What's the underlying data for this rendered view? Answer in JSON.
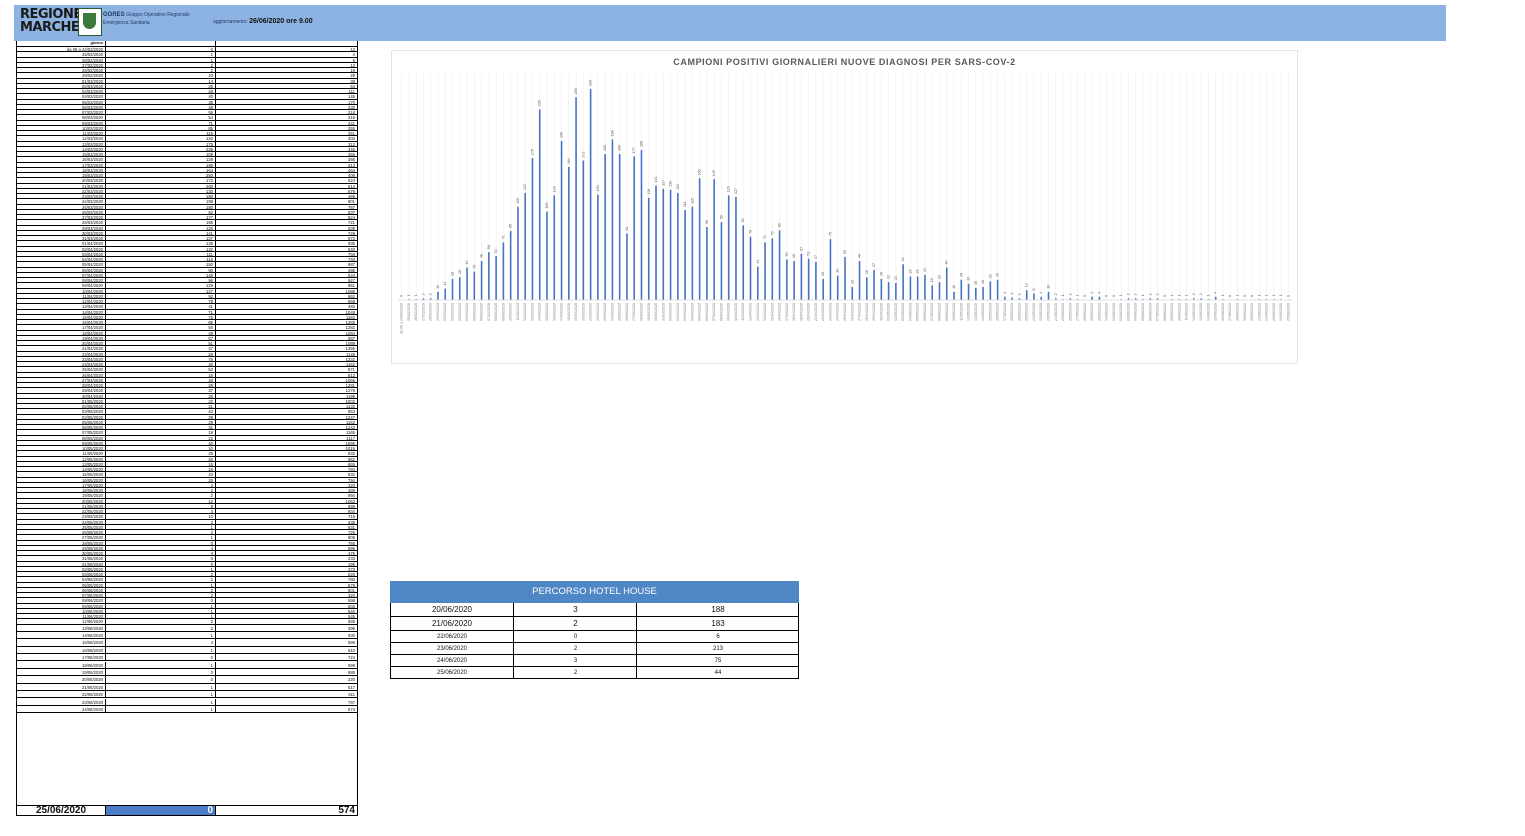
{
  "header": {
    "logo_line1": "REGIONE",
    "logo_line2": "MARCHE",
    "org_name": "GORES",
    "org_line1": "Gruppo Operativo Regionale",
    "org_line2": "Emergenza Sanitaria",
    "update_label": "aggiornamento:",
    "update_value": "26/06/2020 ore 9.00"
  },
  "table": {
    "col0_header": "giorno",
    "rows": [
      [
        "da 06 a 24/02/2020",
        "0",
        "12"
      ],
      [
        "25/02/2020",
        "1",
        "4"
      ],
      [
        "26/02/2020",
        "1",
        "6"
      ],
      [
        "27/02/2020",
        "2",
        "13"
      ],
      [
        "28/02/2020",
        "2",
        "19"
      ],
      [
        "29/02/2020",
        "10",
        "29"
      ],
      [
        "01/03/2020",
        "14",
        "38"
      ],
      [
        "02/03/2020",
        "26",
        "64"
      ],
      [
        "03/03/2020",
        "28",
        "111"
      ],
      [
        "04/03/2020",
        "40",
        "145"
      ],
      [
        "05/03/2020",
        "35",
        "170"
      ],
      [
        "06/03/2020",
        "48",
        "230"
      ],
      [
        "07/03/2020",
        "59",
        "218"
      ],
      [
        "08/03/2020",
        "54",
        "216"
      ],
      [
        "09/03/2020",
        "71",
        "241"
      ],
      [
        "10/03/2020",
        "85",
        "255"
      ],
      [
        "11/03/2020",
        "115",
        "251"
      ],
      [
        "12/03/2020",
        "132",
        "303"
      ],
      [
        "13/03/2020",
        "175",
        "312"
      ],
      [
        "14/03/2020",
        "235",
        "346"
      ],
      [
        "15/03/2020",
        "109",
        "355"
      ],
      [
        "16/03/2020",
        "129",
        "386"
      ],
      [
        "17/03/2020",
        "196",
        "413"
      ],
      [
        "18/03/2020",
        "164",
        "464"
      ],
      [
        "19/03/2020",
        "250",
        "409"
      ],
      [
        "20/03/2020",
        "172",
        "524"
      ],
      [
        "21/03/2020",
        "260",
        "614"
      ],
      [
        "22/03/2020",
        "130",
        "579"
      ],
      [
        "23/03/2020",
        "180",
        "469"
      ],
      [
        "24/03/2020",
        "198",
        "801"
      ],
      [
        "25/03/2020",
        "180",
        "767"
      ],
      [
        "26/03/2020",
        "82",
        "837"
      ],
      [
        "27/03/2020",
        "177",
        "824"
      ],
      [
        "28/03/2020",
        "185",
        "721"
      ],
      [
        "29/03/2020",
        "126",
        "538"
      ],
      [
        "30/03/2020",
        "141",
        "749"
      ],
      [
        "31/03/2020",
        "137",
        "872"
      ],
      [
        "01/04/2020",
        "136",
        "936"
      ],
      [
        "02/04/2020",
        "132",
        "840"
      ],
      [
        "03/04/2020",
        "111",
        "794"
      ],
      [
        "04/04/2020",
        "115",
        "740"
      ],
      [
        "05/04/2020",
        "150",
        "687"
      ],
      [
        "06/04/2020",
        "90",
        "496"
      ],
      [
        "07/04/2020",
        "149",
        "934"
      ],
      [
        "08/04/2020",
        "96",
        "947"
      ],
      [
        "09/04/2020",
        "129",
        "961"
      ],
      [
        "10/04/2020",
        "127",
        "1088"
      ],
      [
        "11/04/2020",
        "92",
        "862"
      ],
      [
        "12/04/2020",
        "78",
        "659"
      ],
      [
        "13/04/2020",
        "41",
        "483"
      ],
      [
        "14/04/2020",
        "71",
        "1049"
      ],
      [
        "15/04/2020",
        "76",
        "1162"
      ],
      [
        "16/04/2020",
        "86",
        "1265"
      ],
      [
        "17/04/2020",
        "50",
        "1282"
      ],
      [
        "18/04/2020",
        "48",
        "1084"
      ],
      [
        "19/04/2020",
        "57",
        "897"
      ],
      [
        "20/04/2020",
        "51",
        "1089"
      ],
      [
        "21/04/2020",
        "47",
        "1255"
      ],
      [
        "22/04/2020",
        "26",
        "1149"
      ],
      [
        "23/04/2020",
        "75",
        "1332"
      ],
      [
        "24/04/2020",
        "30",
        "1162"
      ],
      [
        "25/04/2020",
        "53",
        "871"
      ],
      [
        "26/04/2020",
        "16",
        "512"
      ],
      [
        "27/04/2020",
        "48",
        "1066"
      ],
      [
        "28/04/2020",
        "28",
        "1281"
      ],
      [
        "29/04/2020",
        "37",
        "1276"
      ],
      [
        "30/04/2020",
        "26",
        "1199"
      ],
      [
        "01/05/2020",
        "22",
        "1002"
      ],
      [
        "02/05/2020",
        "21",
        "1132"
      ],
      [
        "03/05/2020",
        "44",
        "653"
      ],
      [
        "04/05/2020",
        "29",
        "1247"
      ],
      [
        "05/05/2020",
        "29",
        "1162"
      ],
      [
        "06/05/2020",
        "31",
        "1243"
      ],
      [
        "07/05/2020",
        "18",
        "1165"
      ],
      [
        "08/05/2020",
        "22",
        "1117"
      ],
      [
        "09/05/2020",
        "40",
        "1086"
      ],
      [
        "10/05/2020",
        "10",
        "1015"
      ],
      [
        "11/05/2020",
        "25",
        "632"
      ],
      [
        "12/05/2020",
        "20",
        "962"
      ],
      [
        "13/05/2020",
        "15",
        "865"
      ],
      [
        "14/05/2020",
        "16",
        "784"
      ],
      [
        "15/05/2020",
        "23",
        "832"
      ],
      [
        "16/05/2020",
        "25",
        "794"
      ],
      [
        "17/05/2020",
        "4",
        "320"
      ],
      [
        "18/05/2020",
        "3",
        "489"
      ],
      [
        "19/05/2020",
        "2",
        "894"
      ],
      [
        "20/05/2020",
        "12",
        "1062"
      ],
      [
        "21/05/2020",
        "8",
        "999"
      ],
      [
        "22/05/2020",
        "4",
        "934"
      ],
      [
        "23/05/2020",
        "10",
        "715"
      ],
      [
        "24/05/2020",
        "2",
        "338"
      ],
      [
        "25/05/2020",
        "1",
        "631"
      ],
      [
        "26/05/2020",
        "2",
        "726"
      ],
      [
        "27/05/2020",
        "1",
        "806"
      ],
      [
        "28/05/2020",
        "0",
        "766"
      ],
      [
        "29/05/2020",
        "4",
        "596"
      ],
      [
        "30/05/2020",
        "4",
        "475"
      ],
      [
        "31/05/2020",
        "0",
        "233"
      ],
      [
        "01/06/2020",
        "0",
        "195"
      ],
      [
        "02/06/2020",
        "1",
        "373"
      ],
      [
        "03/06/2020",
        "2",
        "620"
      ],
      [
        "04/06/2020",
        "2",
        "760"
      ],
      [
        "05/06/2020",
        "1",
        "578"
      ],
      [
        "06/06/2020",
        "2",
        "601"
      ],
      [
        "07/06/2020",
        "2",
        "320"
      ],
      [
        "08/06/2020",
        "0",
        "598"
      ],
      [
        "09/06/2020",
        "1",
        "603"
      ],
      [
        "10/06/2020",
        "1",
        "640"
      ],
      [
        "11/06/2020",
        "1",
        "545"
      ],
      [
        "12/06/2020",
        "2",
        "585"
      ],
      [
        "13/06/2020",
        "2",
        "396"
      ],
      [
        "14/06/2020",
        "1",
        "630"
      ],
      [
        "15/06/2020",
        "4",
        "595"
      ],
      [
        "16/06/2020",
        "1",
        "510"
      ],
      [
        "17/06/2020",
        "0",
        "724"
      ],
      [
        "18/06/2020",
        "1",
        "599"
      ],
      [
        "19/06/2020",
        "0",
        "686"
      ],
      [
        "20/06/2020",
        "0",
        "220"
      ],
      [
        "21/06/2020",
        "1",
        "517"
      ],
      [
        "22/06/2020",
        "1",
        "611"
      ],
      [
        "23/06/2020",
        "1",
        "797"
      ],
      [
        "24/06/2020",
        "1",
        "574"
      ]
    ],
    "footer": [
      "25/06/2020",
      "0",
      "574"
    ]
  },
  "chart_data": {
    "type": "bar",
    "title": "CAMPIONI POSITIVI GIORNALIERI NUOVE DIAGNOSI PER SARS-COV-2",
    "categories": [
      "da 06 a 24/02/2020",
      "25/02/2020",
      "26/02/2020",
      "27/02/2020",
      "28/02/2020",
      "29/02/2020",
      "01/03/2020",
      "02/03/2020",
      "03/03/2020",
      "04/03/2020",
      "05/03/2020",
      "06/03/2020",
      "07/03/2020",
      "08/03/2020",
      "09/03/2020",
      "10/03/2020",
      "11/03/2020",
      "12/03/2020",
      "13/03/2020",
      "14/03/2020",
      "15/03/2020",
      "16/03/2020",
      "17/03/2020",
      "18/03/2020",
      "19/03/2020",
      "20/03/2020",
      "21/03/2020",
      "22/03/2020",
      "23/03/2020",
      "24/03/2020",
      "25/03/2020",
      "26/03/2020",
      "27/03/2020",
      "28/03/2020",
      "29/03/2020",
      "30/03/2020",
      "31/03/2020",
      "01/04/2020",
      "02/04/2020",
      "03/04/2020",
      "04/04/2020",
      "05/04/2020",
      "06/04/2020",
      "07/04/2020",
      "08/04/2020",
      "09/04/2020",
      "10/04/2020",
      "11/04/2020",
      "12/04/2020",
      "13/04/2020",
      "14/04/2020",
      "15/04/2020",
      "16/04/2020",
      "17/04/2020",
      "18/04/2020",
      "19/04/2020",
      "20/04/2020",
      "21/04/2020",
      "22/04/2020",
      "23/04/2020",
      "24/04/2020",
      "25/04/2020",
      "26/04/2020",
      "27/04/2020",
      "28/04/2020",
      "29/04/2020",
      "30/04/2020",
      "01/05/2020",
      "02/05/2020",
      "03/05/2020",
      "04/05/2020",
      "05/05/2020",
      "06/05/2020",
      "07/05/2020",
      "08/05/2020",
      "09/05/2020",
      "10/05/2020",
      "11/05/2020",
      "12/05/2020",
      "13/05/2020",
      "14/05/2020",
      "15/05/2020",
      "16/05/2020",
      "17/05/2020",
      "18/05/2020",
      "19/05/2020",
      "20/05/2020",
      "21/05/2020",
      "22/05/2020",
      "23/05/2020",
      "24/05/2020",
      "25/05/2020",
      "26/05/2020",
      "27/05/2020",
      "28/05/2020",
      "29/05/2020",
      "30/05/2020",
      "31/05/2020",
      "01/06/2020",
      "02/06/2020",
      "03/06/2020",
      "04/06/2020",
      "05/06/2020",
      "06/06/2020",
      "07/06/2020",
      "08/06/2020",
      "09/06/2020",
      "10/06/2020",
      "11/06/2020",
      "12/06/2020",
      "13/06/2020",
      "14/06/2020",
      "15/06/2020",
      "16/06/2020",
      "17/06/2020",
      "18/06/2020",
      "19/06/2020",
      "20/06/2020",
      "21/06/2020",
      "22/06/2020",
      "23/06/2020",
      "24/06/2020",
      "25/06/2020"
    ],
    "values": [
      0,
      1,
      1,
      2,
      2,
      10,
      14,
      26,
      28,
      40,
      35,
      48,
      59,
      54,
      71,
      85,
      115,
      132,
      175,
      235,
      109,
      129,
      196,
      164,
      250,
      172,
      260,
      130,
      180,
      198,
      180,
      82,
      177,
      185,
      126,
      141,
      137,
      136,
      132,
      111,
      115,
      150,
      90,
      149,
      96,
      129,
      127,
      92,
      78,
      41,
      71,
      76,
      86,
      50,
      48,
      57,
      51,
      47,
      26,
      75,
      30,
      53,
      16,
      48,
      28,
      37,
      26,
      22,
      21,
      44,
      29,
      29,
      31,
      18,
      22,
      40,
      10,
      25,
      20,
      15,
      16,
      23,
      25,
      4,
      3,
      2,
      12,
      8,
      4,
      10,
      2,
      1,
      2,
      1,
      0,
      4,
      4,
      0,
      0,
      1,
      2,
      2,
      1,
      2,
      2,
      0,
      1,
      1,
      1,
      2,
      2,
      1,
      4,
      1,
      0,
      1,
      0,
      0,
      1,
      1,
      1,
      1,
      0
    ],
    "ylim": [
      0,
      270
    ],
    "grid": true
  },
  "hotel": {
    "title": "PERCORSO HOTEL HOUSE",
    "rows": [
      [
        "20/06/2020",
        "3",
        "188"
      ],
      [
        "21/06/2020",
        "2",
        "183"
      ],
      [
        "22/06/2020",
        "0",
        "6"
      ],
      [
        "23/06/2020",
        "2",
        "213"
      ],
      [
        "24/06/2020",
        "3",
        "75"
      ],
      [
        "25/06/2020",
        "2",
        "44"
      ]
    ]
  },
  "colors": {
    "banner": "#8db3e2",
    "bar": "#4472c4",
    "hotel_header": "#4f86c6",
    "highlight": "#4a7cc7"
  }
}
